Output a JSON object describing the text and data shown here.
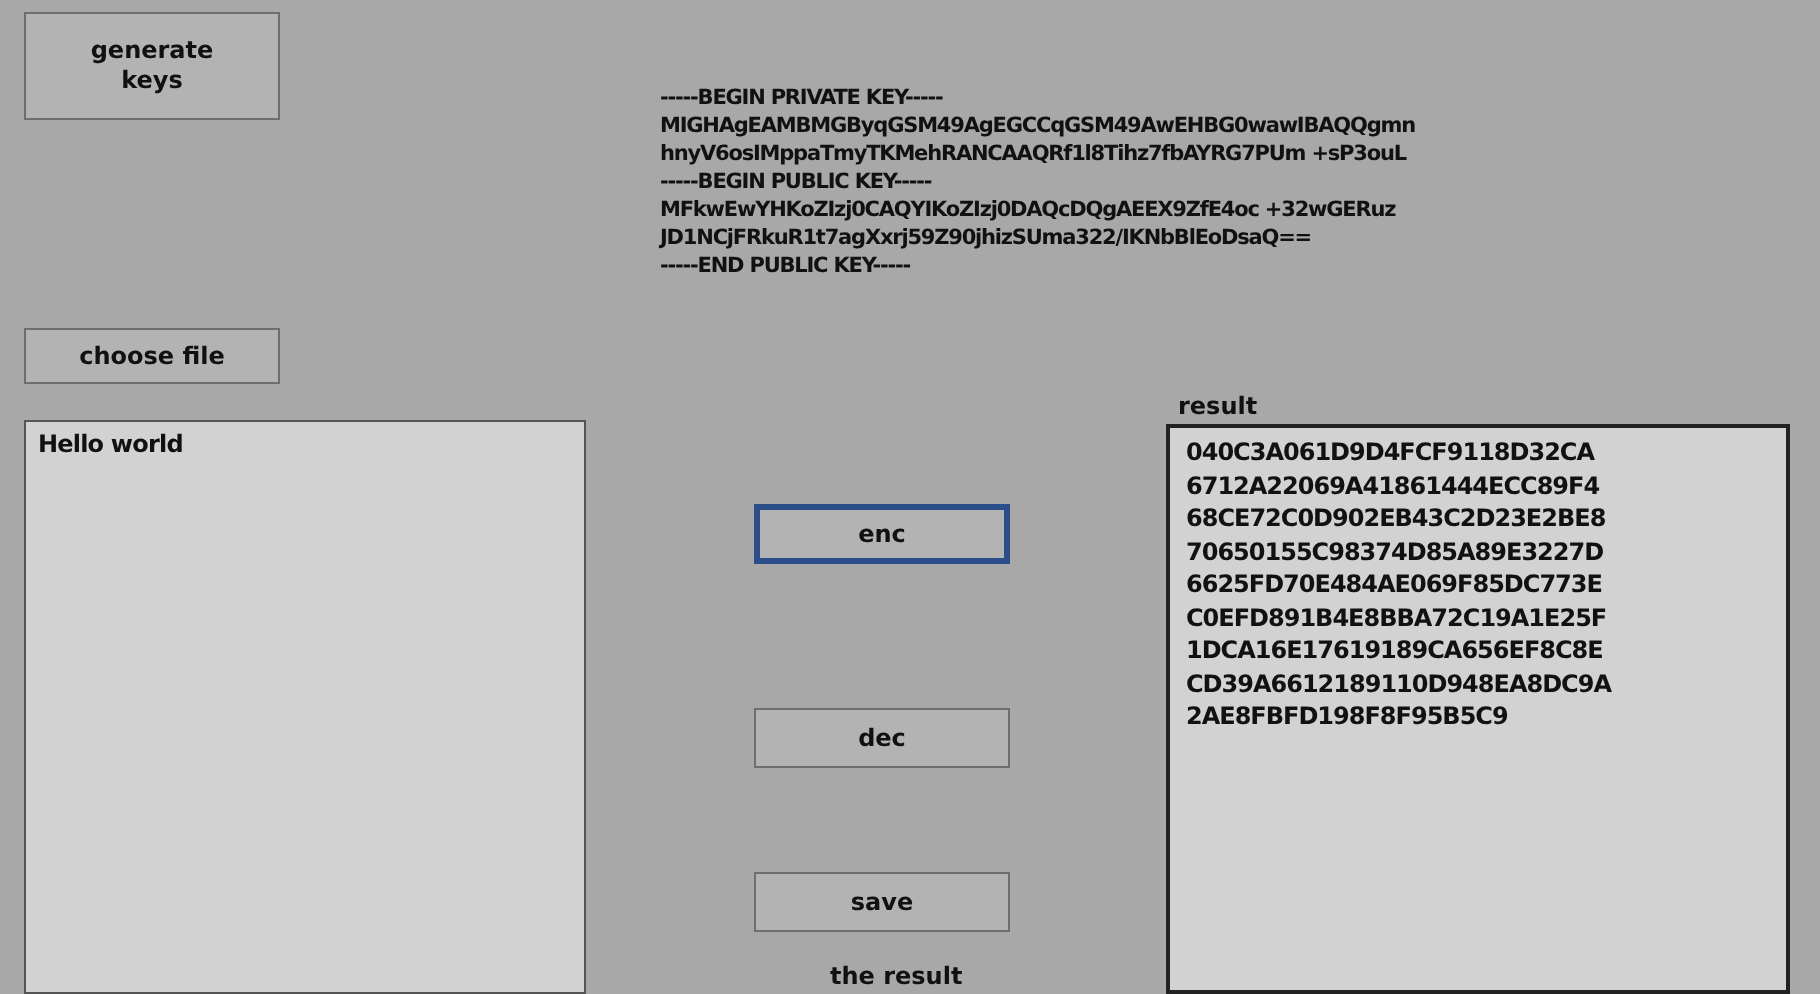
{
  "generate_button": {
    "label": "generate\nkeys"
  },
  "key_text": [
    "-----BEGIN PRIVATE KEY-----",
    "MIGHAgEAMBMGByqGSM49AgEGCCqGSM49AwEHBG0wawIBAQQgmn",
    "hnyV6osIMppaTmyTKMehRANCAAQRf1l8Tihz7fbAYRG7PUm +sP3ouL",
    "-----BEGIN PUBLIC KEY-----",
    "MFkwEwYHKoZIzj0CAQYIKoZIzj0DAQcDQgAEEX9ZfE4oc +32wGERuz",
    "JD1NCjFRkuR1t7agXxrj59Z90jhizSUma322/IKNbBlEoDsaQ==",
    "-----END PUBLIC KEY-----"
  ],
  "choose_file_button": {
    "label": "choose file"
  },
  "input_text": "Hello world",
  "action_buttons": [
    {
      "label": "enc",
      "focused": true
    },
    {
      "label": "dec",
      "focused": false
    },
    {
      "label": "save",
      "focused": false
    }
  ],
  "result_caption": "the result",
  "result": {
    "label": "result",
    "lines": [
      "040C3A061D9D4FCF9118D32CA",
      "6712A22069A41861444ECC89F4",
      "68CE72C0D902EB43C2D23E2BE8",
      "70650155C98374D85A89E3227D",
      "6625FD70E484AE069F85DC773E",
      "C0EFD891B4E8BBA72C19A1E25F",
      "1DCA16E17619189CA656EF8C8E",
      "CD39A6612189110D948EA8DC9A",
      "2AE8FBFD198F8F95B5C9"
    ]
  }
}
